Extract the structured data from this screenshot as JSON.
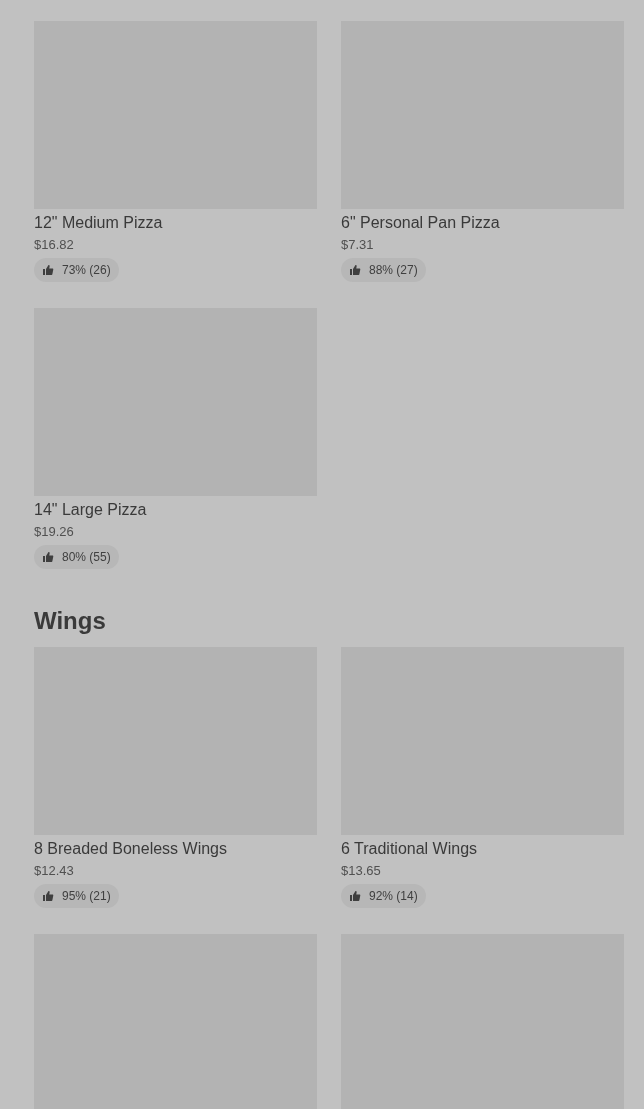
{
  "sections": [
    {
      "items": [
        {
          "kind": "full",
          "name": "12\" Medium Pizza",
          "price": "$16.82",
          "rating": "73% (26)"
        },
        {
          "kind": "full",
          "name": "6\" Personal Pan Pizza",
          "price": "$7.31",
          "rating": "88% (27)"
        },
        {
          "kind": "full",
          "name": "14\" Large Pizza",
          "price": "$19.26",
          "rating": "80% (55)"
        }
      ]
    },
    {
      "title": "Wings",
      "items": [
        {
          "kind": "full",
          "name": "8 Breaded Boneless Wings",
          "price": "$12.43",
          "rating": "95% (21)"
        },
        {
          "kind": "full",
          "name": "6 Traditional Wings",
          "price": "$13.65",
          "rating": "92% (14)"
        },
        {
          "kind": "image_only"
        },
        {
          "kind": "image_only"
        }
      ]
    }
  ]
}
